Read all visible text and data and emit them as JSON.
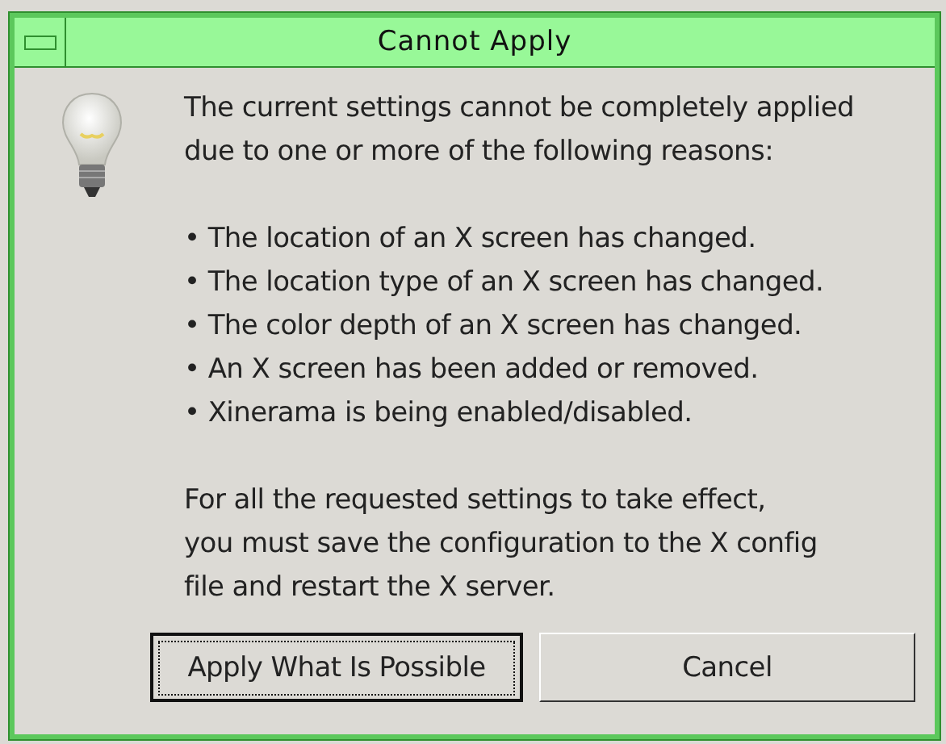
{
  "window": {
    "title": "Cannot Apply"
  },
  "message": {
    "intro": [
      "The current settings cannot be completely applied",
      "due to one or more of the following reasons:"
    ],
    "reasons": [
      "• The location of an X screen has changed.",
      "• The location type of an X screen has changed.",
      "• The color depth of an X screen has changed.",
      "• An X screen has been added or removed.",
      "• Xinerama is being enabled/disabled."
    ],
    "outro": [
      "For all the requested settings to take effect,",
      "you must save the configuration to the X config",
      "file and restart the X server."
    ]
  },
  "buttons": [
    {
      "label": "Apply What Is Possible",
      "focused": true
    },
    {
      "label": "Cancel",
      "focused": false
    }
  ]
}
